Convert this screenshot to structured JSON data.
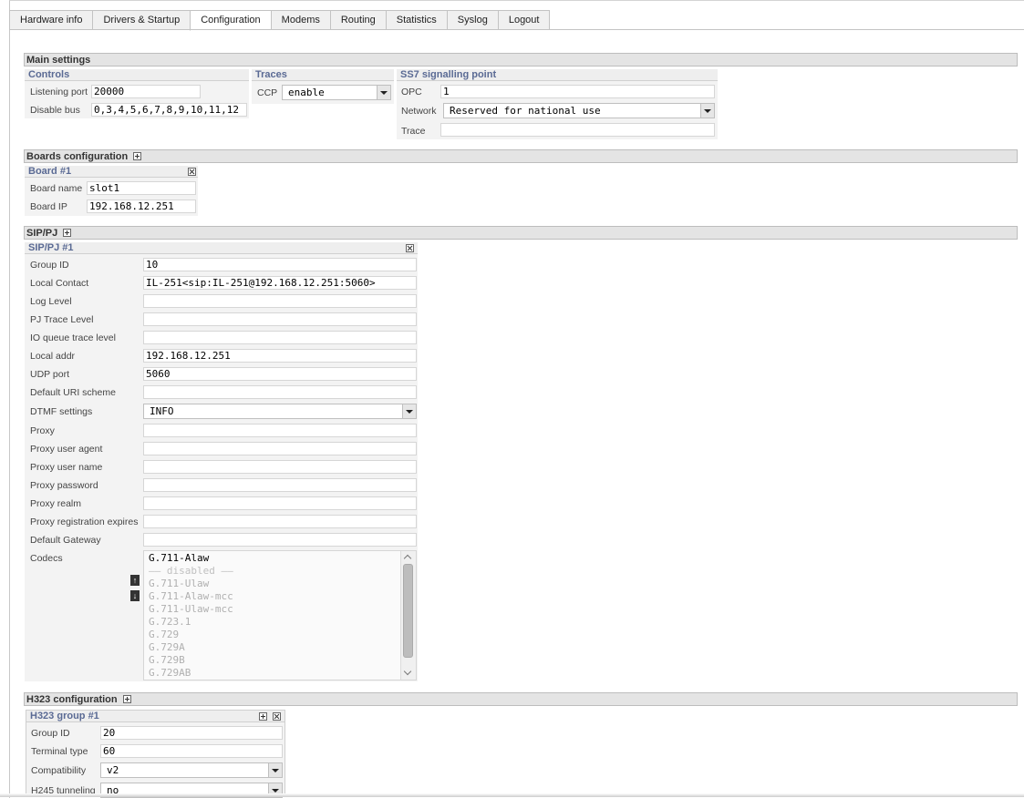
{
  "tabs": [
    {
      "label": "Hardware info"
    },
    {
      "label": "Drivers & Startup"
    },
    {
      "label": "Configuration",
      "active": true
    },
    {
      "label": "Modems"
    },
    {
      "label": "Routing"
    },
    {
      "label": "Statistics"
    },
    {
      "label": "Syslog"
    },
    {
      "label": "Logout"
    }
  ],
  "main_settings": {
    "title": "Main settings",
    "controls": {
      "title": "Controls",
      "listening_port_label": "Listening port",
      "listening_port_value": "20000",
      "disable_bus_label": "Disable bus",
      "disable_bus_value": "0,3,4,5,6,7,8,9,10,11,12"
    },
    "traces": {
      "title": "Traces",
      "ccp_label": "CCP",
      "ccp_value": "enable"
    },
    "ss7": {
      "title": "SS7 signalling point",
      "opc_label": "OPC",
      "opc_value": "1",
      "network_label": "Network",
      "network_value": "Reserved for national use",
      "trace_label": "Trace",
      "trace_value": ""
    }
  },
  "boards": {
    "title": "Boards configuration",
    "board_title": "Board #1",
    "board_name_label": "Board name",
    "board_name_value": "slot1",
    "board_ip_label": "Board IP",
    "board_ip_value": "192.168.12.251"
  },
  "sip": {
    "title": "SIP/PJ",
    "group_title": "SIP/PJ #1",
    "fields": [
      {
        "label": "Group ID",
        "value": "10"
      },
      {
        "label": "Local Contact",
        "value": "IL-251<sip:IL-251@192.168.12.251:5060>"
      },
      {
        "label": "Log Level",
        "value": ""
      },
      {
        "label": "PJ Trace Level",
        "value": ""
      },
      {
        "label": "IO queue trace level",
        "value": ""
      },
      {
        "label": "Local addr",
        "value": "192.168.12.251"
      },
      {
        "label": "UDP port",
        "value": "5060"
      },
      {
        "label": "Default URI scheme",
        "value": ""
      },
      {
        "label": "DTMF settings",
        "value": "INFO"
      },
      {
        "label": "Proxy",
        "value": ""
      },
      {
        "label": "Proxy user agent",
        "value": ""
      },
      {
        "label": "Proxy user name",
        "value": ""
      },
      {
        "label": "Proxy password",
        "value": ""
      },
      {
        "label": "Proxy realm",
        "value": ""
      },
      {
        "label": "Proxy registration expires",
        "value": ""
      },
      {
        "label": "Default Gateway",
        "value": ""
      },
      {
        "label": "Codecs",
        "value": ""
      }
    ],
    "codecs_enabled": [
      "G.711-Alaw"
    ],
    "codecs_separator": "—— disabled ——",
    "codecs_disabled": [
      "G.711-Ulaw",
      "G.711-Alaw-mcc",
      "G.711-Ulaw-mcc",
      "G.723.1",
      "G.729",
      "G.729A",
      "G.729B",
      "G.729AB"
    ]
  },
  "h323": {
    "title": "H323 configuration",
    "group_title": "H323 group #1",
    "group_id_label": "Group ID",
    "group_id_value": "20",
    "terminal_type_label": "Terminal type",
    "terminal_type_value": "60",
    "compatibility_label": "Compatibility",
    "compatibility_value": "v2",
    "h245_label": "H245 tunneling",
    "h245_value": "no"
  },
  "icons": {
    "expand": "plus-box-icon",
    "close": "close-box-icon",
    "move_up": "arrow-up-icon",
    "move_down": "arrow-down-icon"
  }
}
